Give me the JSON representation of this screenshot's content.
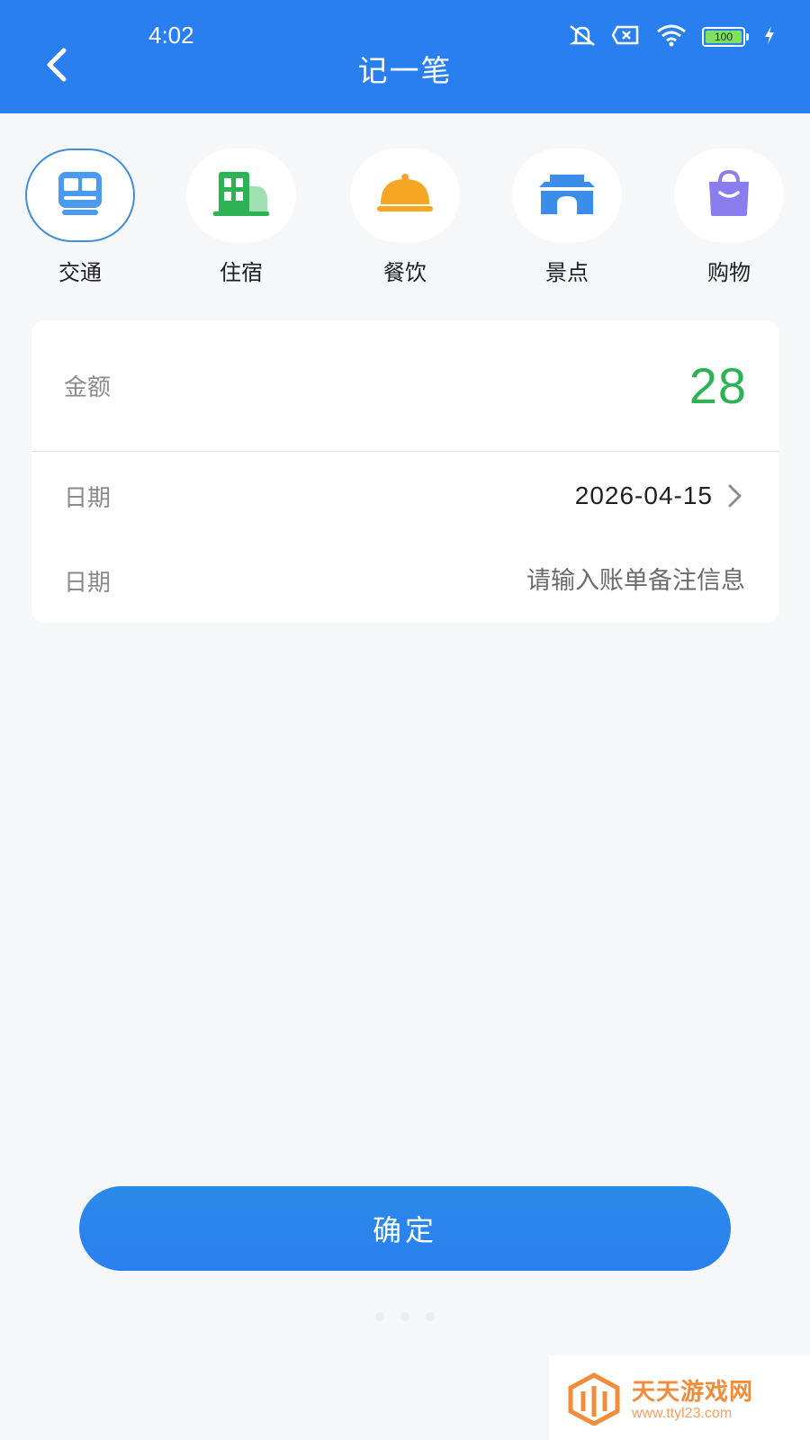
{
  "status_bar": {
    "time": "4:02",
    "battery": "100",
    "battery_level": 1.0,
    "icons": [
      "mute-icon",
      "close-box-icon",
      "wifi-icon",
      "battery-icon",
      "charging-icon"
    ]
  },
  "header": {
    "title": "记一笔",
    "back_icon": "back-arrow-icon",
    "background_color": "#2a7ff0"
  },
  "categories": [
    {
      "label": "交通",
      "icon": "train-icon",
      "color": "#4a9bf0",
      "selected": true
    },
    {
      "label": "住宿",
      "icon": "building-icon",
      "color": "#2db353",
      "selected": false
    },
    {
      "label": "餐饮",
      "icon": "food-cloche-icon",
      "color": "#f5a623",
      "selected": false
    },
    {
      "label": "景点",
      "icon": "gate-icon",
      "color": "#3b8de8",
      "selected": false
    },
    {
      "label": "购物",
      "icon": "shopping-bag-icon",
      "color": "#8b7cf0",
      "selected": false
    }
  ],
  "form": {
    "amount_label": "金额",
    "amount_value": "28",
    "amount_color": "#2db353",
    "date_label": "日期",
    "date_value": "2026-04-15",
    "note_label": "日期",
    "note_placeholder": "请输入账单备注信息"
  },
  "confirm_button": {
    "label": "确定"
  },
  "watermark": {
    "text": "天天游戏网",
    "url": "www.ttyl23.com"
  }
}
